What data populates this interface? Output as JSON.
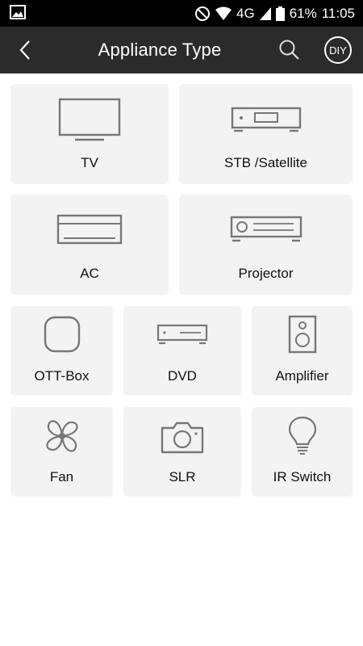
{
  "status_bar": {
    "battery": "61%",
    "time": "11:05",
    "network": "4G"
  },
  "app_bar": {
    "title": "Appliance Type",
    "diy_label": "DIY"
  },
  "appliances": [
    {
      "label": "TV"
    },
    {
      "label": "STB /Satellite"
    },
    {
      "label": "AC"
    },
    {
      "label": "Projector"
    },
    {
      "label": "OTT-Box"
    },
    {
      "label": "DVD"
    },
    {
      "label": "Amplifier"
    },
    {
      "label": "Fan"
    },
    {
      "label": "SLR"
    },
    {
      "label": "IR Switch"
    }
  ]
}
